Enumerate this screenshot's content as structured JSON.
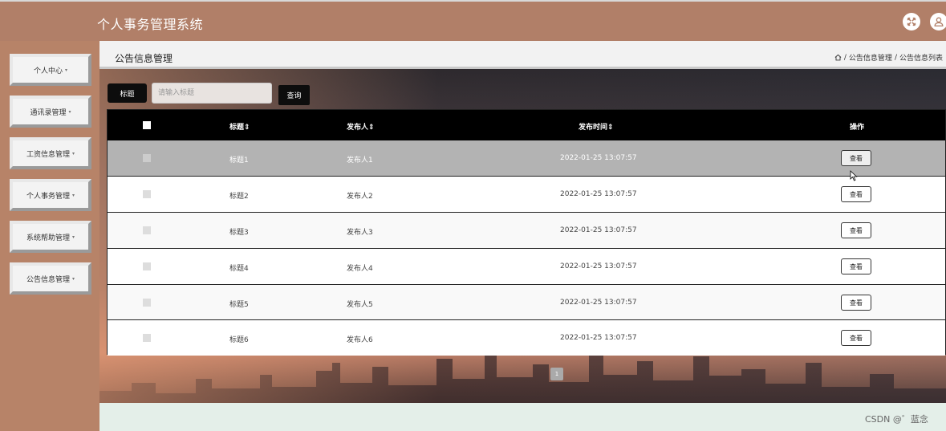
{
  "header": {
    "title": "个人事务管理系统"
  },
  "sidebar": {
    "items": [
      {
        "label": "个人中心"
      },
      {
        "label": "通讯录管理"
      },
      {
        "label": "工资信息管理"
      },
      {
        "label": "个人事务管理"
      },
      {
        "label": "系统帮助管理"
      },
      {
        "label": "公告信息管理"
      }
    ],
    "caret": "▾"
  },
  "page": {
    "title": "公告信息管理",
    "breadcrumb": [
      "公告信息管理",
      "公告信息列表"
    ],
    "breadcrumb_separator": "/"
  },
  "search": {
    "label": "标题",
    "placeholder": "请输入标题",
    "value": "",
    "button": "查询"
  },
  "table": {
    "headers": {
      "title": "标题",
      "publisher": "发布人",
      "publish_time": "发布时间",
      "actions": "操作"
    },
    "sort_icon": "⇕",
    "rows": [
      {
        "title": "标题1",
        "publisher": "发布人1",
        "time": "2022-01-25 13:07:57",
        "action": "查看"
      },
      {
        "title": "标题2",
        "publisher": "发布人2",
        "time": "2022-01-25 13:07:57",
        "action": "查看"
      },
      {
        "title": "标题3",
        "publisher": "发布人3",
        "time": "2022-01-25 13:07:57",
        "action": "查看"
      },
      {
        "title": "标题4",
        "publisher": "发布人4",
        "time": "2022-01-25 13:07:57",
        "action": "查看"
      },
      {
        "title": "标题5",
        "publisher": "发布人5",
        "time": "2022-01-25 13:07:57",
        "action": "查看"
      },
      {
        "title": "标题6",
        "publisher": "发布人6",
        "time": "2022-01-25 13:07:57",
        "action": "查看"
      }
    ],
    "hovered_row": 0
  },
  "pagination": {
    "current": "1"
  },
  "watermark": "CSDN @゛蓝念",
  "colors": {
    "header_bg": "#b17f68",
    "sidebar_bg": "#b78368",
    "table_head_bg": "#000000",
    "hover_row_bg": "#b3b3b3"
  },
  "icons": {
    "header": [
      "fullscreen-icon",
      "user-icon"
    ],
    "breadcrumb": "home-icon"
  }
}
